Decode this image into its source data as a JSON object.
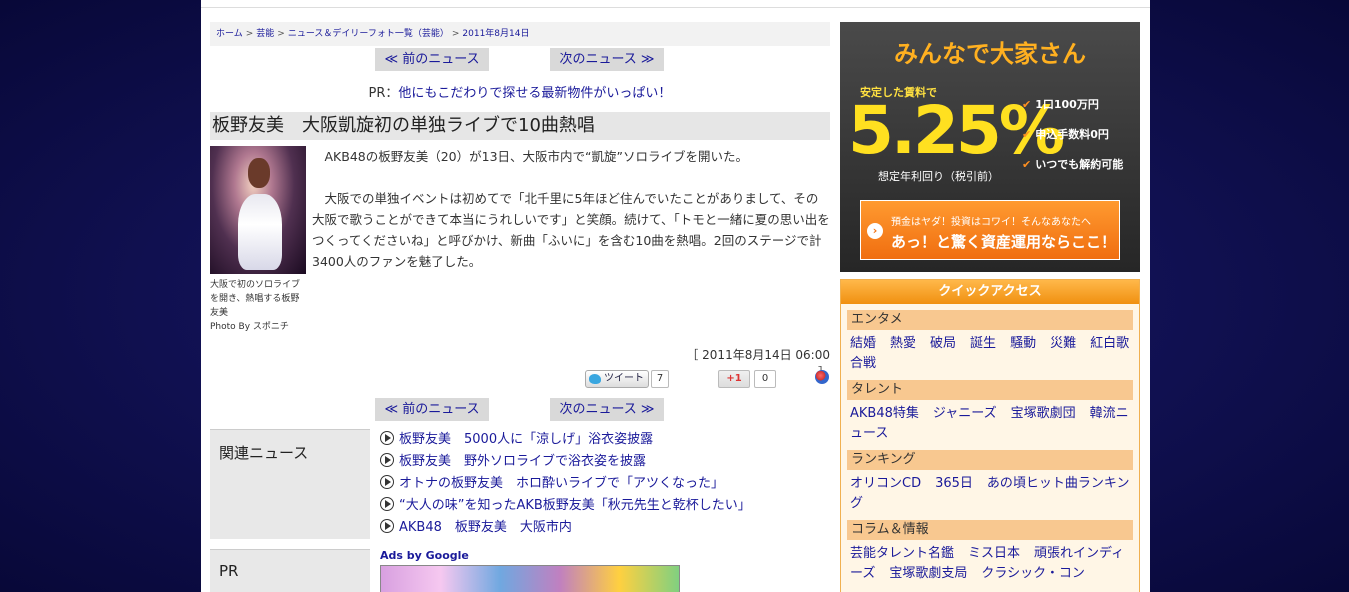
{
  "breadcrumb": [
    "ホーム",
    "芸能",
    "ニュース＆デイリーフォト一覧（芸能）",
    "2011年8月14日"
  ],
  "nav": {
    "prev": "≪ 前のニュース",
    "next": "次のニュース ≫"
  },
  "pr_line": {
    "prefix": "PR：",
    "link": "他にもこだわりで探せる最新物件がいっぱい！"
  },
  "article": {
    "headline": "板野友美　大阪凱旋初の単独ライブで10曲熱唱",
    "caption": "大阪で初のソロライブを開き、熱唱する板野友美",
    "credit": "Photo By スポニチ",
    "paragraphs": [
      "AKB48の板野友美（20）が13日、大阪市内で“凱旋”ソロライブを開いた。",
      "大阪での単独イベントは初めてで「北千里に5年ほど住んでいたことがありまして、その大阪で歌うことができて本当にうれしいです」と笑顔。続けて、「トモと一緒に夏の思い出をつくってくださいね」と呼びかけ、新曲「ふいに」を含む10曲を熱唱。2回のステージで計3400人のファンを魅了した。"
    ],
    "dateline": "［ 2011年8月14日 06:00 ］"
  },
  "social": {
    "tweet_label": "ツイート",
    "tweet_count": "7",
    "gplus_label": "+1",
    "gplus_count": "0"
  },
  "related": {
    "heading": "関連ニュース",
    "items": [
      "板野友美　5000人に「涼しげ」浴衣姿披露",
      "板野友美　野外ソロライブで浴衣姿を披露",
      "オトナの板野友美　ホロ酔いライブで「アツくなった」",
      "“大人の味”を知ったAKB板野友美「秋元先生と乾杯したい」",
      "AKB48　板野友美　大阪市内"
    ]
  },
  "pr_section": {
    "heading": "PR",
    "ads_label": "Ads by Google"
  },
  "banner": {
    "title": "みんなで大家さん",
    "subtitle": "安定した賃料で",
    "rate": "5.25%",
    "note": "想定年利回り（税引前）",
    "features": [
      "1口100万円",
      "申込手数料0円",
      "いつでも解約可能"
    ],
    "cta_line1": "預金はヤダ！投資はコワイ！そんなあなたへ",
    "cta_line2": "あっ！と驚く資産運用ならここ！"
  },
  "quick_access": {
    "title": "クイックアクセス",
    "sections": [
      {
        "name": "エンタメ",
        "links": [
          "結婚",
          "熱愛",
          "破局",
          "誕生",
          "騒動",
          "災難",
          "紅白歌合戦"
        ]
      },
      {
        "name": "タレント",
        "links": [
          "AKB48特集",
          "ジャニーズ",
          "宝塚歌劇団",
          "韓流ニュース"
        ]
      },
      {
        "name": "ランキング",
        "links": [
          "オリコンCD",
          "365日",
          "あの頃ヒット曲ランキング"
        ]
      },
      {
        "name": "コラム＆情報",
        "links": [
          "芸能タレント名鑑",
          "ミス日本",
          "頑張れインディーズ",
          "宝塚歌劇支局",
          "クラシック・コン"
        ]
      }
    ]
  }
}
